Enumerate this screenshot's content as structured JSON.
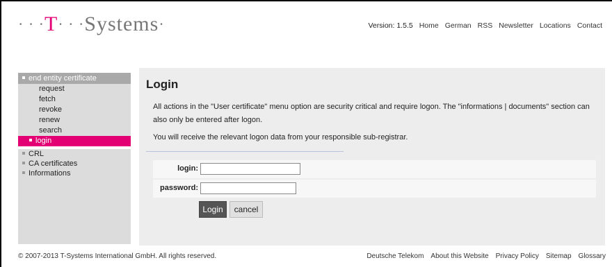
{
  "header": {
    "logo_dots_left": "· · ·",
    "logo_t": "T",
    "logo_dots_mid": "· · ·",
    "logo_text": "Systems",
    "logo_dot_right": "·",
    "version": "Version: 1.5.5",
    "nav": [
      "Home",
      "German",
      "RSS",
      "Newsletter",
      "Locations",
      "Contact"
    ]
  },
  "sidebar": {
    "section_title": "end entity certificate",
    "sub_items": [
      "request",
      "fetch",
      "revoke",
      "renew",
      "search"
    ],
    "active_item": "login",
    "main_items": [
      "CRL",
      "CA certificates",
      "Informations"
    ]
  },
  "content": {
    "title": "Login",
    "paragraph1": "All actions in the \"User certificate\" menu option are security critical and require logon. The \"informations | documents\" section can also only be entered after logon.",
    "paragraph2": "You will receive the relevant logon data from your responsible sub-registrar.",
    "login_label": "login:",
    "login_value": "",
    "password_label": "password:",
    "password_value": "",
    "login_button": "Login",
    "cancel_button": "cancel"
  },
  "footer": {
    "copyright": "© 2007-2013 T-Systems International GmbH. All rights reserved.",
    "links": [
      "Deutsche Telekom",
      "About this Website",
      "Privacy Policy",
      "Sitemap",
      "Glossary"
    ]
  },
  "colors": {
    "brand_magenta": "#e20074",
    "sidebar_bg": "#dcdcdc",
    "content_bg": "#ededed"
  }
}
